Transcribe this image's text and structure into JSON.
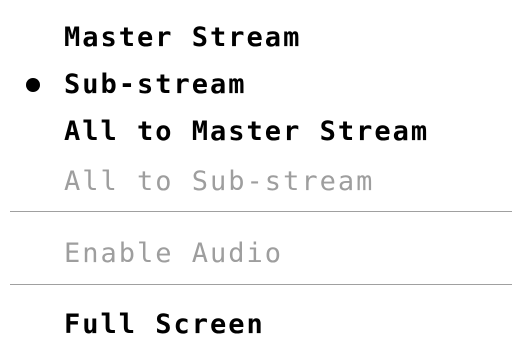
{
  "menu": {
    "items": [
      {
        "label": "Master Stream",
        "enabled": true,
        "selected": false
      },
      {
        "label": "Sub-stream",
        "enabled": true,
        "selected": true
      },
      {
        "label": "All to Master Stream",
        "enabled": true,
        "selected": false
      },
      {
        "label": "All to Sub-stream",
        "enabled": false,
        "selected": false
      },
      {
        "label": "Enable Audio",
        "enabled": false,
        "selected": false
      },
      {
        "label": "Full Screen",
        "enabled": true,
        "selected": false
      }
    ],
    "selected_indicator": "radio-dot-icon",
    "colors": {
      "text": "#000000",
      "disabled_text": "#9e9e9e",
      "separator": "#a0a0a0",
      "background": "#ffffff"
    }
  }
}
